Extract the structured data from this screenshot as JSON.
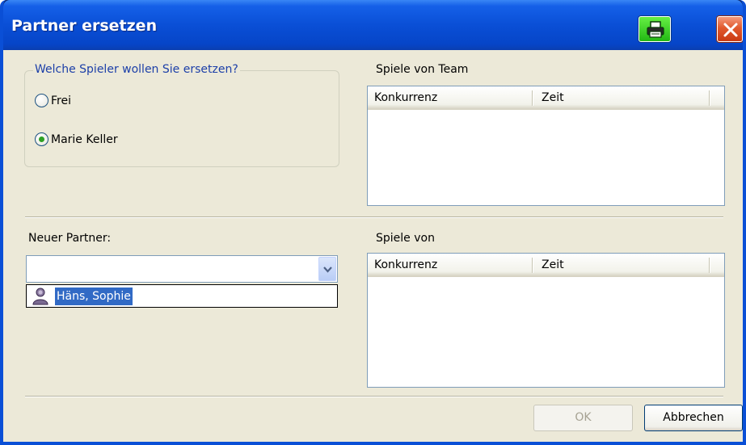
{
  "window": {
    "title": "Partner ersetzen"
  },
  "titlebar": {
    "print_icon": "printer-icon",
    "close_icon": "close-icon"
  },
  "replace_group": {
    "legend": "Welche Spieler wollen Sie ersetzen?",
    "options": [
      {
        "label": "Frei",
        "checked": false
      },
      {
        "label": "Marie Keller",
        "checked": true
      }
    ]
  },
  "team_games": {
    "label": "Spiele von Team",
    "columns": [
      "Konkurrenz",
      "Zeit"
    ],
    "rows": []
  },
  "new_partner": {
    "label": "Neuer Partner:",
    "value": "",
    "dropdown_items": [
      {
        "label": "Häns, Sophie",
        "icon": "person-icon",
        "selected": true
      }
    ]
  },
  "partner_games": {
    "label": "Spiele von",
    "columns": [
      "Konkurrenz",
      "Zeit"
    ],
    "rows": []
  },
  "buttons": {
    "ok": "OK",
    "cancel": "Abbrechen"
  },
  "colors": {
    "title_bar": "#0a4fd6",
    "selection": "#316ac5",
    "group_legend": "#1c3fa8",
    "client_bg": "#ece9d8"
  }
}
